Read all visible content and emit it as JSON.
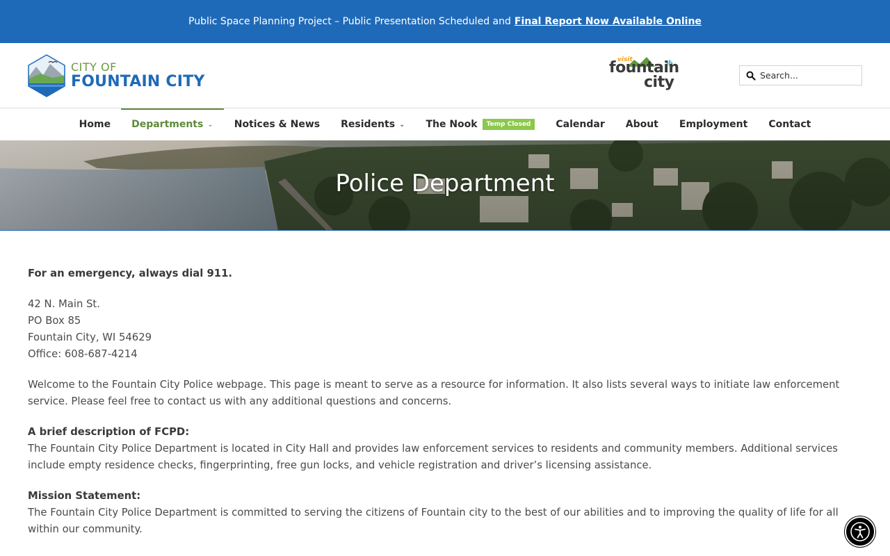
{
  "banner": {
    "text": "Public Space Planning Project – Public Presentation Scheduled and",
    "link": "Final Report Now Available Online"
  },
  "logo": {
    "line1": "CITY OF",
    "line2": "FOUNTAIN CITY"
  },
  "visit_logo": {
    "small": "visit",
    "word1": "fountain",
    "word2": "city"
  },
  "search": {
    "placeholder": "Search..."
  },
  "nav": {
    "items": [
      {
        "label": "Home"
      },
      {
        "label": "Departments"
      },
      {
        "label": "Notices & News"
      },
      {
        "label": "Residents"
      },
      {
        "label": "The Nook",
        "badge": "Temp Closed"
      },
      {
        "label": "Calendar"
      },
      {
        "label": "About"
      },
      {
        "label": "Employment"
      },
      {
        "label": "Contact"
      }
    ],
    "active_color": "#5e8a3a",
    "badge_color": "#8cc84b"
  },
  "hero": {
    "title": "Police Department"
  },
  "content": {
    "emergency": "For an emergency, always dial 911.",
    "address": {
      "line1": "42 N. Main St.",
      "line2": "PO Box 85",
      "line3": "Fountain City, WI 54629",
      "line4": "Office: 608-687-4214"
    },
    "welcome": "Welcome to the Fountain City Police webpage.  This page is meant to serve as a resource for information.  It also lists several ways to initiate law enforcement service.  Please feel free to contact us with any additional questions and concerns.",
    "brief_heading": "A brief description of FCPD:",
    "brief_text": "The Fountain City Police Department is located in City Hall and provides law enforcement services to residents and community members.  Additional services include empty residence checks, fingerprinting, free gun locks, and vehicle registration and driver’s licensing assistance.",
    "mission_heading": "Mission Statement:",
    "mission_text": "The Fountain City Police Department is committed to serving the citizens of Fountain city to the best of our abilities and to improving the quality of life for all within our community."
  },
  "colors": {
    "banner_blue": "#1f6ab8",
    "green": "#5e8a3a"
  },
  "icons": {
    "search": "search-icon",
    "accessibility": "accessibility-icon"
  }
}
